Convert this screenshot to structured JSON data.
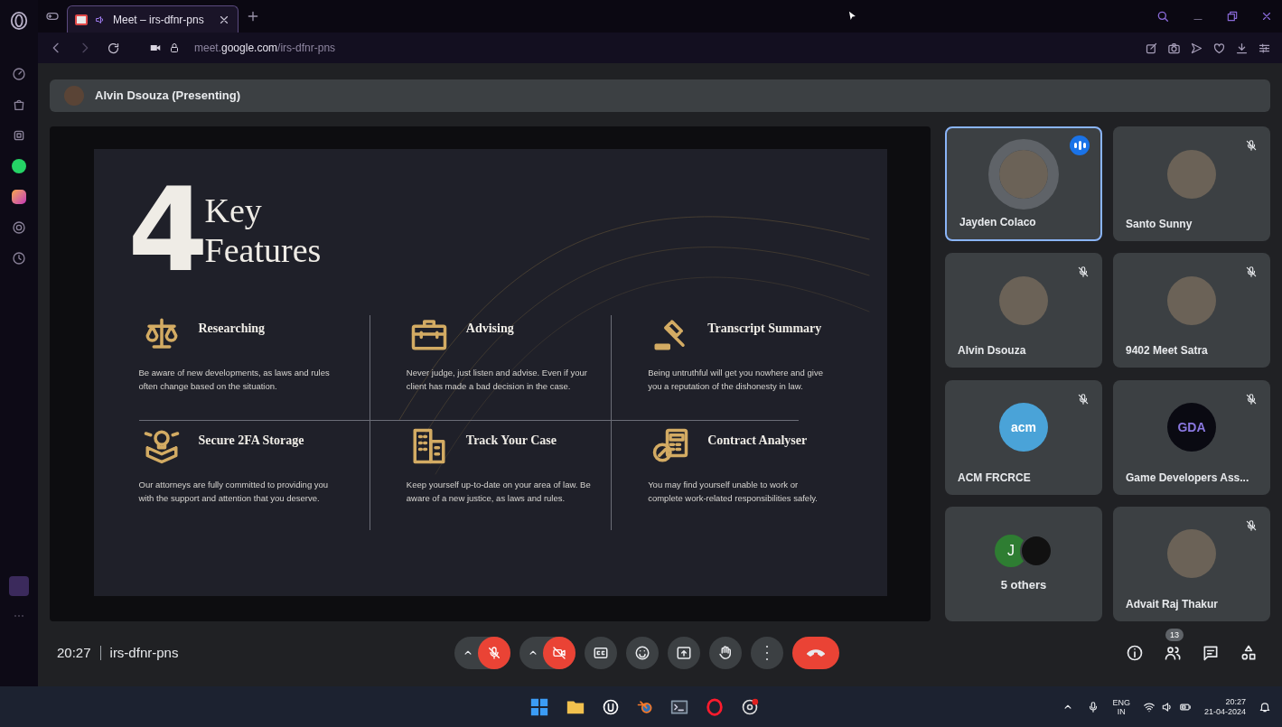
{
  "browser": {
    "tabs": [
      {
        "title": "Meet – irs-dfnr-pns",
        "selected": true,
        "audio": true
      }
    ],
    "url": "meet.**google.com**/irs-dfnr-pns"
  },
  "presenter": {
    "label": "Alvin Dsouza (Presenting)"
  },
  "slide": {
    "number": "4",
    "title_lines": [
      "Key",
      "Features"
    ],
    "features": [
      {
        "kind": "scales",
        "heading": "Researching",
        "body": "Be aware of new developments, as laws and rules often change based on the situation."
      },
      {
        "kind": "briefcase",
        "heading": "Advising",
        "body": "Never judge, just listen and advise. Even if your client has made a bad decision in the case."
      },
      {
        "kind": "gavel",
        "heading": "Transcript Summary",
        "body": "Being untruthful will get you nowhere and give you a reputation of the dishonesty in law."
      },
      {
        "kind": "idea",
        "heading": "Secure 2FA Storage",
        "body": "Our attorneys are fully committed to providing you with the support and attention that you deserve."
      },
      {
        "kind": "buildings",
        "heading": "Track Your Case",
        "body": "Keep yourself up-to-date on your area of law. Be aware of a new justice, as laws and rules."
      },
      {
        "kind": "calculator",
        "heading": "Contract Analyser",
        "body": "You may find yourself unable to work or complete work-related responsibilities safely."
      }
    ]
  },
  "participants": [
    {
      "kind": "person",
      "name": "Jayden Colaco",
      "muted": false,
      "speaking": true,
      "selected": true
    },
    {
      "kind": "person",
      "name": "Santo Sunny",
      "muted": true,
      "speaking": false,
      "selected": false
    },
    {
      "kind": "person",
      "name": "Alvin Dsouza",
      "muted": true,
      "speaking": false,
      "selected": false
    },
    {
      "kind": "person",
      "name": "9402 Meet Satra",
      "muted": true,
      "speaking": false,
      "selected": false
    },
    {
      "kind": "logo",
      "name": "ACM FRCRCE",
      "logo_text": "acm",
      "muted": true,
      "speaking": false,
      "selected": false
    },
    {
      "kind": "logo",
      "name": "Game Developers Ass...",
      "logo_text": "GDA",
      "muted": true,
      "speaking": false,
      "selected": false
    },
    {
      "kind": "others",
      "name": "5 others",
      "initial": "J",
      "selected": false
    },
    {
      "kind": "person",
      "name": "Advait Raj Thakur",
      "muted": true,
      "speaking": false,
      "selected": false
    }
  ],
  "meeting": {
    "time": "20:27",
    "code": "irs-dfnr-pns",
    "people_count": "13",
    "controls": [
      {
        "kind": "mic",
        "on": false
      },
      {
        "kind": "camera",
        "on": false
      },
      {
        "kind": "captions"
      },
      {
        "kind": "emoji"
      },
      {
        "kind": "present"
      },
      {
        "kind": "hand"
      },
      {
        "kind": "more"
      },
      {
        "kind": "leave"
      }
    ]
  },
  "taskbar": {
    "language": "ENG",
    "region": "IN",
    "time": "20:27",
    "date": "21-04-2024"
  }
}
